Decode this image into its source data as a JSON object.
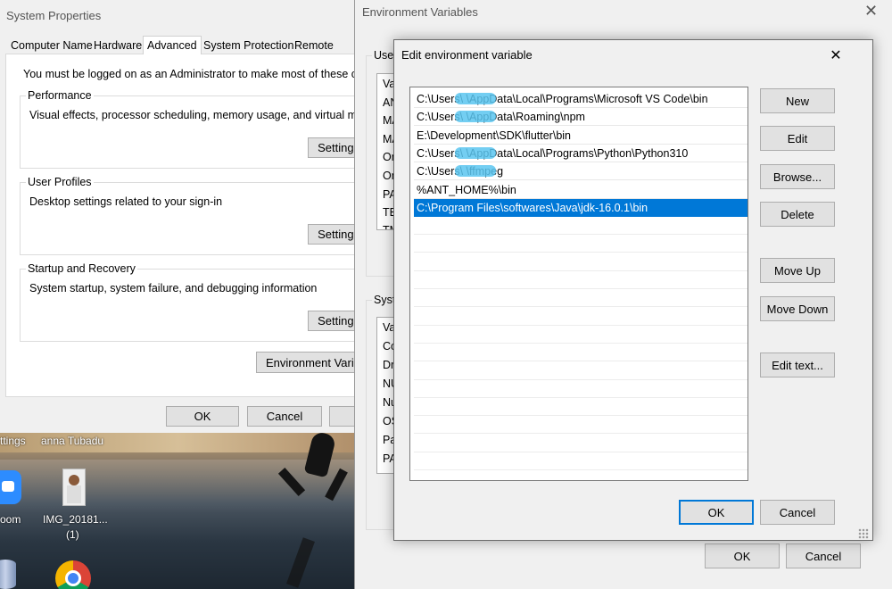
{
  "system_properties": {
    "title": "System Properties",
    "tabs": [
      "Computer Name",
      "Hardware",
      "Advanced",
      "System Protection",
      "Remote"
    ],
    "admin_notice": "You must be logged on as an Administrator to make most of these changes.",
    "performance": {
      "title": "Performance",
      "description": "Visual effects, processor scheduling, memory usage, and virtual memory",
      "settings_label": "Settings..."
    },
    "user_profiles": {
      "title": "User Profiles",
      "description": "Desktop settings related to your sign-in",
      "settings_label": "Settings..."
    },
    "startup_recovery": {
      "title": "Startup and Recovery",
      "description": "System startup, system failure, and debugging information",
      "settings_label": "Settings..."
    },
    "env_vars_label": "Environment Variables...",
    "ok_label": "OK",
    "cancel_label": "Cancel"
  },
  "desktop": {
    "icon_labels": [
      "ttings",
      "anna Tubadu",
      "oom",
      "IMG_20181...",
      "(1)"
    ]
  },
  "environment_variables": {
    "title": "Environment Variables",
    "user_section_label": "User",
    "user_stub_lines": [
      "Va",
      "AN",
      "MA",
      "MA",
      "On",
      "On",
      "PA",
      "TE",
      "TM"
    ],
    "system_section_label": "Syste",
    "system_stub_lines": [
      "Va",
      "Co",
      "Dr",
      "NU",
      "Nu",
      "OS",
      "Pa",
      "PA"
    ],
    "ok_label": "OK",
    "cancel_label": "Cancel"
  },
  "edit_dialog": {
    "title": "Edit environment variable",
    "paths": [
      "C:\\Users\\      \\AppData\\Local\\Programs\\Microsoft VS Code\\bin",
      "C:\\Users\\      \\AppData\\Roaming\\npm",
      "E:\\Development\\SDK\\flutter\\bin",
      "C:\\Users\\      \\AppData\\Local\\Programs\\Python\\Python310",
      "C:\\Users\\      \\ffmpeg",
      "%ANT_HOME%\\bin",
      "C:\\Program Files\\softwares\\Java\\jdk-16.0.1\\bin"
    ],
    "selected_index": 6,
    "buttons": {
      "new": "New",
      "edit": "Edit",
      "browse": "Browse...",
      "delete": "Delete",
      "move_up": "Move Up",
      "move_down": "Move Down",
      "edit_text": "Edit text..."
    },
    "ok_label": "OK",
    "cancel_label": "Cancel"
  },
  "colors": {
    "selection": "#0078d7",
    "redaction": "#5bc6f0"
  }
}
